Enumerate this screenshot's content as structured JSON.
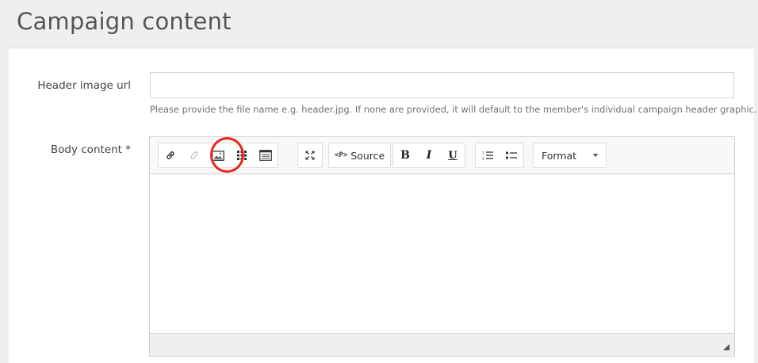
{
  "page": {
    "title": "Campaign content"
  },
  "form": {
    "header_image": {
      "label": "Header image url",
      "value": "",
      "placeholder": "",
      "help": "Please provide the file name e.g. header.jpg. If none are provided, it will default to the member's individual campaign header graphic."
    },
    "body_content": {
      "label": "Body content *"
    }
  },
  "editor": {
    "toolbar": {
      "link_icon": "link-icon",
      "unlink_icon": "unlink-icon",
      "image_icon": "image-icon",
      "table_icon": "table-icon",
      "template_icon": "template-icon",
      "maximize_icon": "maximize-icon",
      "source_tag": "<P>",
      "source_label": "Source",
      "bold_label": "B",
      "italic_label": "I",
      "underline_label": "U",
      "numbered_list_icon": "numbered-list-icon",
      "bulleted_list_icon": "bulleted-list-icon",
      "format_label": "Format"
    },
    "content": ""
  },
  "annotation": {
    "highlight_color": "#e8281e",
    "highlighted": "image-button"
  }
}
